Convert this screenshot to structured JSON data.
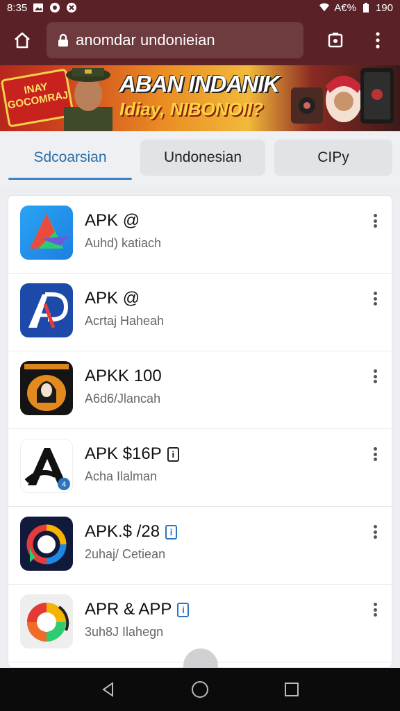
{
  "status_bar": {
    "time": "8:35",
    "battery_text": "A€%",
    "signal_text": "190"
  },
  "toolbar": {
    "url": "anomdar undonieian"
  },
  "banner": {
    "badge_text": "INAY GOCOMRAJ",
    "title": "ABAN INDANIK",
    "subtitle": "Idiay, NIBONOII?"
  },
  "tabs": [
    {
      "label": "Sdcoarsian",
      "active": true
    },
    {
      "label": "Undonesian",
      "active": false
    },
    {
      "label": "CIPy",
      "active": false
    }
  ],
  "apps": [
    {
      "title": "APK @",
      "subtitle": "Auhd) katiach",
      "icon": "gradient-a-icon",
      "badge": ""
    },
    {
      "title": "APK @",
      "subtitle": "Acrtaj Haheah",
      "icon": "ap-logo-icon",
      "badge": ""
    },
    {
      "title": "APKK 100",
      "subtitle": "A6d6/Jlancah",
      "icon": "hooded-figure-icon",
      "badge": ""
    },
    {
      "title": "APK $16P",
      "subtitle": "Acha Ilalman",
      "icon": "black-a-icon",
      "badge": "black"
    },
    {
      "title": "APK.$ /28",
      "subtitle": "2uhaj/ Cetiean",
      "icon": "ring-chat-icon",
      "badge": "blue"
    },
    {
      "title": "APR & APP",
      "subtitle": "3uh8J Ilahegn",
      "icon": "color-wheel-icon",
      "badge": "blue"
    }
  ],
  "colors": {
    "chrome": "#5a2226",
    "accent": "#3b82c4"
  }
}
